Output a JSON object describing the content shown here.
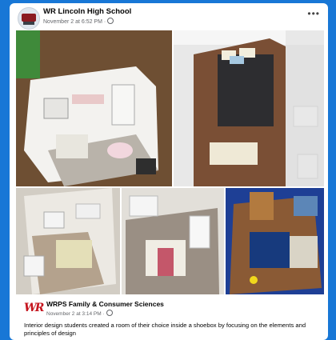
{
  "post": {
    "author": "WR Lincoln High School",
    "timestamp": "November 2 at 6:52 PM ·",
    "more_icon": "more-options-icon",
    "privacy_icon": "globe-icon"
  },
  "gallery": {
    "photos": [
      {
        "subject": "shoebox bedroom with bed and shelves"
      },
      {
        "subject": "shoebox bedroom with dark bed and wood floor"
      },
      {
        "subject": "shoebox bathroom and bedroom"
      },
      {
        "subject": "shoebox bedroom with pink bedding"
      },
      {
        "subject": "shoebox room with blue walls and desk"
      }
    ]
  },
  "shared": {
    "page_name": "WRPS Family & Consumer Sciences",
    "timestamp": "November 2 at 3:14 PM ·",
    "logo_text": "WR",
    "text": "Interior design students created a room of their choice inside a shoebox by focusing on the elements and principles of design"
  },
  "colors": {
    "background": "#1877d6",
    "card": "#ffffff",
    "logo_red": "#c5151e"
  }
}
